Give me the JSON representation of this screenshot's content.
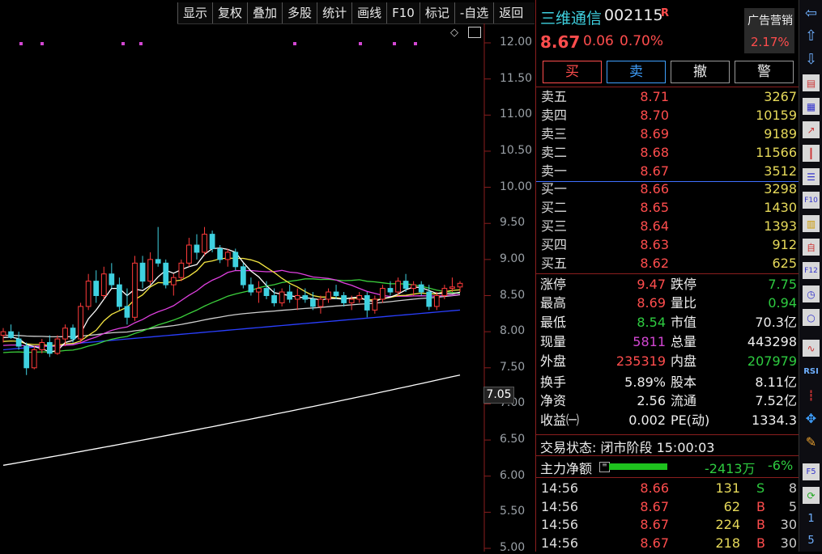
{
  "toolbar": {
    "items": [
      "显示",
      "复权",
      "叠加",
      "多股",
      "统计",
      "画线",
      "F10",
      "标记",
      "-自选",
      "返回"
    ]
  },
  "stock": {
    "name": "三维通信",
    "code": "002115",
    "flag": "R",
    "price": "8.67",
    "change": "0.06",
    "change_pct": "0.70%",
    "sector_name": "广告营销",
    "sector_pct": "2.17%"
  },
  "trade_buttons": {
    "buy": "买",
    "sell": "卖",
    "cancel": "撤",
    "alert": "警"
  },
  "asks": [
    {
      "label": "卖五",
      "price": "8.71",
      "vol": "3267"
    },
    {
      "label": "卖四",
      "price": "8.70",
      "vol": "10159"
    },
    {
      "label": "卖三",
      "price": "8.69",
      "vol": "9189"
    },
    {
      "label": "卖二",
      "price": "8.68",
      "vol": "11566"
    },
    {
      "label": "卖一",
      "price": "8.67",
      "vol": "3512"
    }
  ],
  "bids": [
    {
      "label": "买一",
      "price": "8.66",
      "vol": "3298"
    },
    {
      "label": "买二",
      "price": "8.65",
      "vol": "1430"
    },
    {
      "label": "买三",
      "price": "8.64",
      "vol": "1393"
    },
    {
      "label": "买四",
      "price": "8.63",
      "vol": "912"
    },
    {
      "label": "买五",
      "price": "8.62",
      "vol": "625"
    }
  ],
  "stats": {
    "limit_up_label": "涨停",
    "limit_up": "9.47",
    "limit_down_label": "跌停",
    "limit_down": "7.75",
    "high_label": "最高",
    "high": "8.69",
    "vol_ratio_label": "量比",
    "vol_ratio": "0.94",
    "low_label": "最低",
    "low": "8.54",
    "mkt_cap_label": "市值",
    "mkt_cap": "70.3亿",
    "cur_vol_label": "现量",
    "cur_vol": "5811",
    "total_vol_label": "总量",
    "total_vol": "443298",
    "outer_label": "外盘",
    "outer": "235319",
    "inner_label": "内盘",
    "inner": "207979",
    "turnover_label": "换手",
    "turnover": "5.89%",
    "equity_label": "股本",
    "equity": "8.11亿",
    "nav_label": "净资",
    "nav": "2.56",
    "float_label": "流通",
    "float": "7.52亿",
    "eps_label": "收益㈠",
    "eps": "0.002",
    "pe_label": "PE(动)",
    "pe": "1334.3"
  },
  "status": {
    "text": "交易状态: 闭市阶段 15:00:03"
  },
  "main_flow": {
    "label": "主力净额",
    "amount": "-2413万",
    "pct": "-6%",
    "bar_fraction": 0.8
  },
  "ticks": [
    {
      "time": "14:56",
      "price": "8.66",
      "vol": "131",
      "side": "S",
      "num": "8"
    },
    {
      "time": "14:56",
      "price": "8.67",
      "vol": "62",
      "side": "B",
      "num": "5"
    },
    {
      "time": "14:56",
      "price": "8.67",
      "vol": "224",
      "side": "B",
      "num": "30"
    },
    {
      "time": "14:56",
      "price": "8.67",
      "vol": "218",
      "side": "B",
      "num": "30"
    }
  ],
  "chart_data": {
    "type": "candlestick",
    "y_ticks": [
      "12.00",
      "11.50",
      "11.00",
      "10.50",
      "10.00",
      "9.50",
      "9.00",
      "8.50",
      "8.00",
      "7.50",
      "7.00",
      "6.50",
      "6.00",
      "5.50",
      "5.00"
    ],
    "ylim": [
      5.0,
      12.0
    ],
    "current_price_label": "7.05",
    "colors": {
      "up": "#ff3b3b",
      "down": "#3fd1e0",
      "ma5": "#ffffff",
      "ma10": "#f5e642",
      "ma20": "#e040e0",
      "ma30": "#3cd13c",
      "ma60": "#cfcfcf",
      "ma120": "#2a3fff",
      "ma250": "#ffffff"
    },
    "candles": [
      [
        7.95,
        8.05,
        7.85,
        8.0
      ],
      [
        8.0,
        8.1,
        7.9,
        7.92
      ],
      [
        7.9,
        8.0,
        7.75,
        7.8
      ],
      [
        7.8,
        7.85,
        7.4,
        7.5
      ],
      [
        7.5,
        7.8,
        7.48,
        7.75
      ],
      [
        7.75,
        7.9,
        7.7,
        7.85
      ],
      [
        7.85,
        7.95,
        7.65,
        7.7
      ],
      [
        7.7,
        7.95,
        7.68,
        7.9
      ],
      [
        7.9,
        8.1,
        7.8,
        8.05
      ],
      [
        8.05,
        8.1,
        7.85,
        7.9
      ],
      [
        7.9,
        8.4,
        7.85,
        8.35
      ],
      [
        8.35,
        8.8,
        8.3,
        8.7
      ],
      [
        8.7,
        8.85,
        8.4,
        8.5
      ],
      [
        8.5,
        8.9,
        8.45,
        8.8
      ],
      [
        8.8,
        8.95,
        8.6,
        8.65
      ],
      [
        8.65,
        8.75,
        8.3,
        8.35
      ],
      [
        8.35,
        8.6,
        8.1,
        8.2
      ],
      [
        8.2,
        9.05,
        8.15,
        8.95
      ],
      [
        8.95,
        9.05,
        8.6,
        8.7
      ],
      [
        8.7,
        9.1,
        8.65,
        9.0
      ],
      [
        9.0,
        9.45,
        8.9,
        8.95
      ],
      [
        8.95,
        9.0,
        8.6,
        8.65
      ],
      [
        8.65,
        8.8,
        8.5,
        8.75
      ],
      [
        8.75,
        9.0,
        8.7,
        8.95
      ],
      [
        8.95,
        9.3,
        8.9,
        9.2
      ],
      [
        9.2,
        9.35,
        9.0,
        9.1
      ],
      [
        9.1,
        9.45,
        9.05,
        9.35
      ],
      [
        9.35,
        9.4,
        9.1,
        9.15
      ],
      [
        9.15,
        9.2,
        8.95,
        9.0
      ],
      [
        9.0,
        9.15,
        8.9,
        9.1
      ],
      [
        9.1,
        9.15,
        8.85,
        8.9
      ],
      [
        8.9,
        8.95,
        8.6,
        8.65
      ],
      [
        8.65,
        8.75,
        8.5,
        8.55
      ],
      [
        8.55,
        8.7,
        8.4,
        8.6
      ],
      [
        8.6,
        8.7,
        8.45,
        8.5
      ],
      [
        8.5,
        8.6,
        8.35,
        8.4
      ],
      [
        8.4,
        8.6,
        8.35,
        8.55
      ],
      [
        8.55,
        8.65,
        8.4,
        8.45
      ],
      [
        8.45,
        8.6,
        8.3,
        8.5
      ],
      [
        8.5,
        8.6,
        8.4,
        8.45
      ],
      [
        8.45,
        8.55,
        8.3,
        8.35
      ],
      [
        8.35,
        8.5,
        8.25,
        8.45
      ],
      [
        8.45,
        8.6,
        8.4,
        8.55
      ],
      [
        8.55,
        8.65,
        8.45,
        8.5
      ],
      [
        8.5,
        8.55,
        8.35,
        8.4
      ],
      [
        8.4,
        8.5,
        8.3,
        8.45
      ],
      [
        8.45,
        8.55,
        8.4,
        8.5
      ],
      [
        8.5,
        8.55,
        8.2,
        8.3
      ],
      [
        8.3,
        8.5,
        8.25,
        8.45
      ],
      [
        8.45,
        8.65,
        8.4,
        8.6
      ],
      [
        8.6,
        8.7,
        8.5,
        8.55
      ],
      [
        8.55,
        8.75,
        8.5,
        8.7
      ],
      [
        8.7,
        8.8,
        8.55,
        8.6
      ],
      [
        8.6,
        8.7,
        8.5,
        8.65
      ],
      [
        8.65,
        8.7,
        8.5,
        8.55
      ],
      [
        8.55,
        8.65,
        8.3,
        8.35
      ],
      [
        8.35,
        8.55,
        8.3,
        8.5
      ],
      [
        8.5,
        8.65,
        8.45,
        8.6
      ],
      [
        8.6,
        8.75,
        8.55,
        8.62
      ],
      [
        8.62,
        8.7,
        8.55,
        8.67
      ]
    ]
  }
}
